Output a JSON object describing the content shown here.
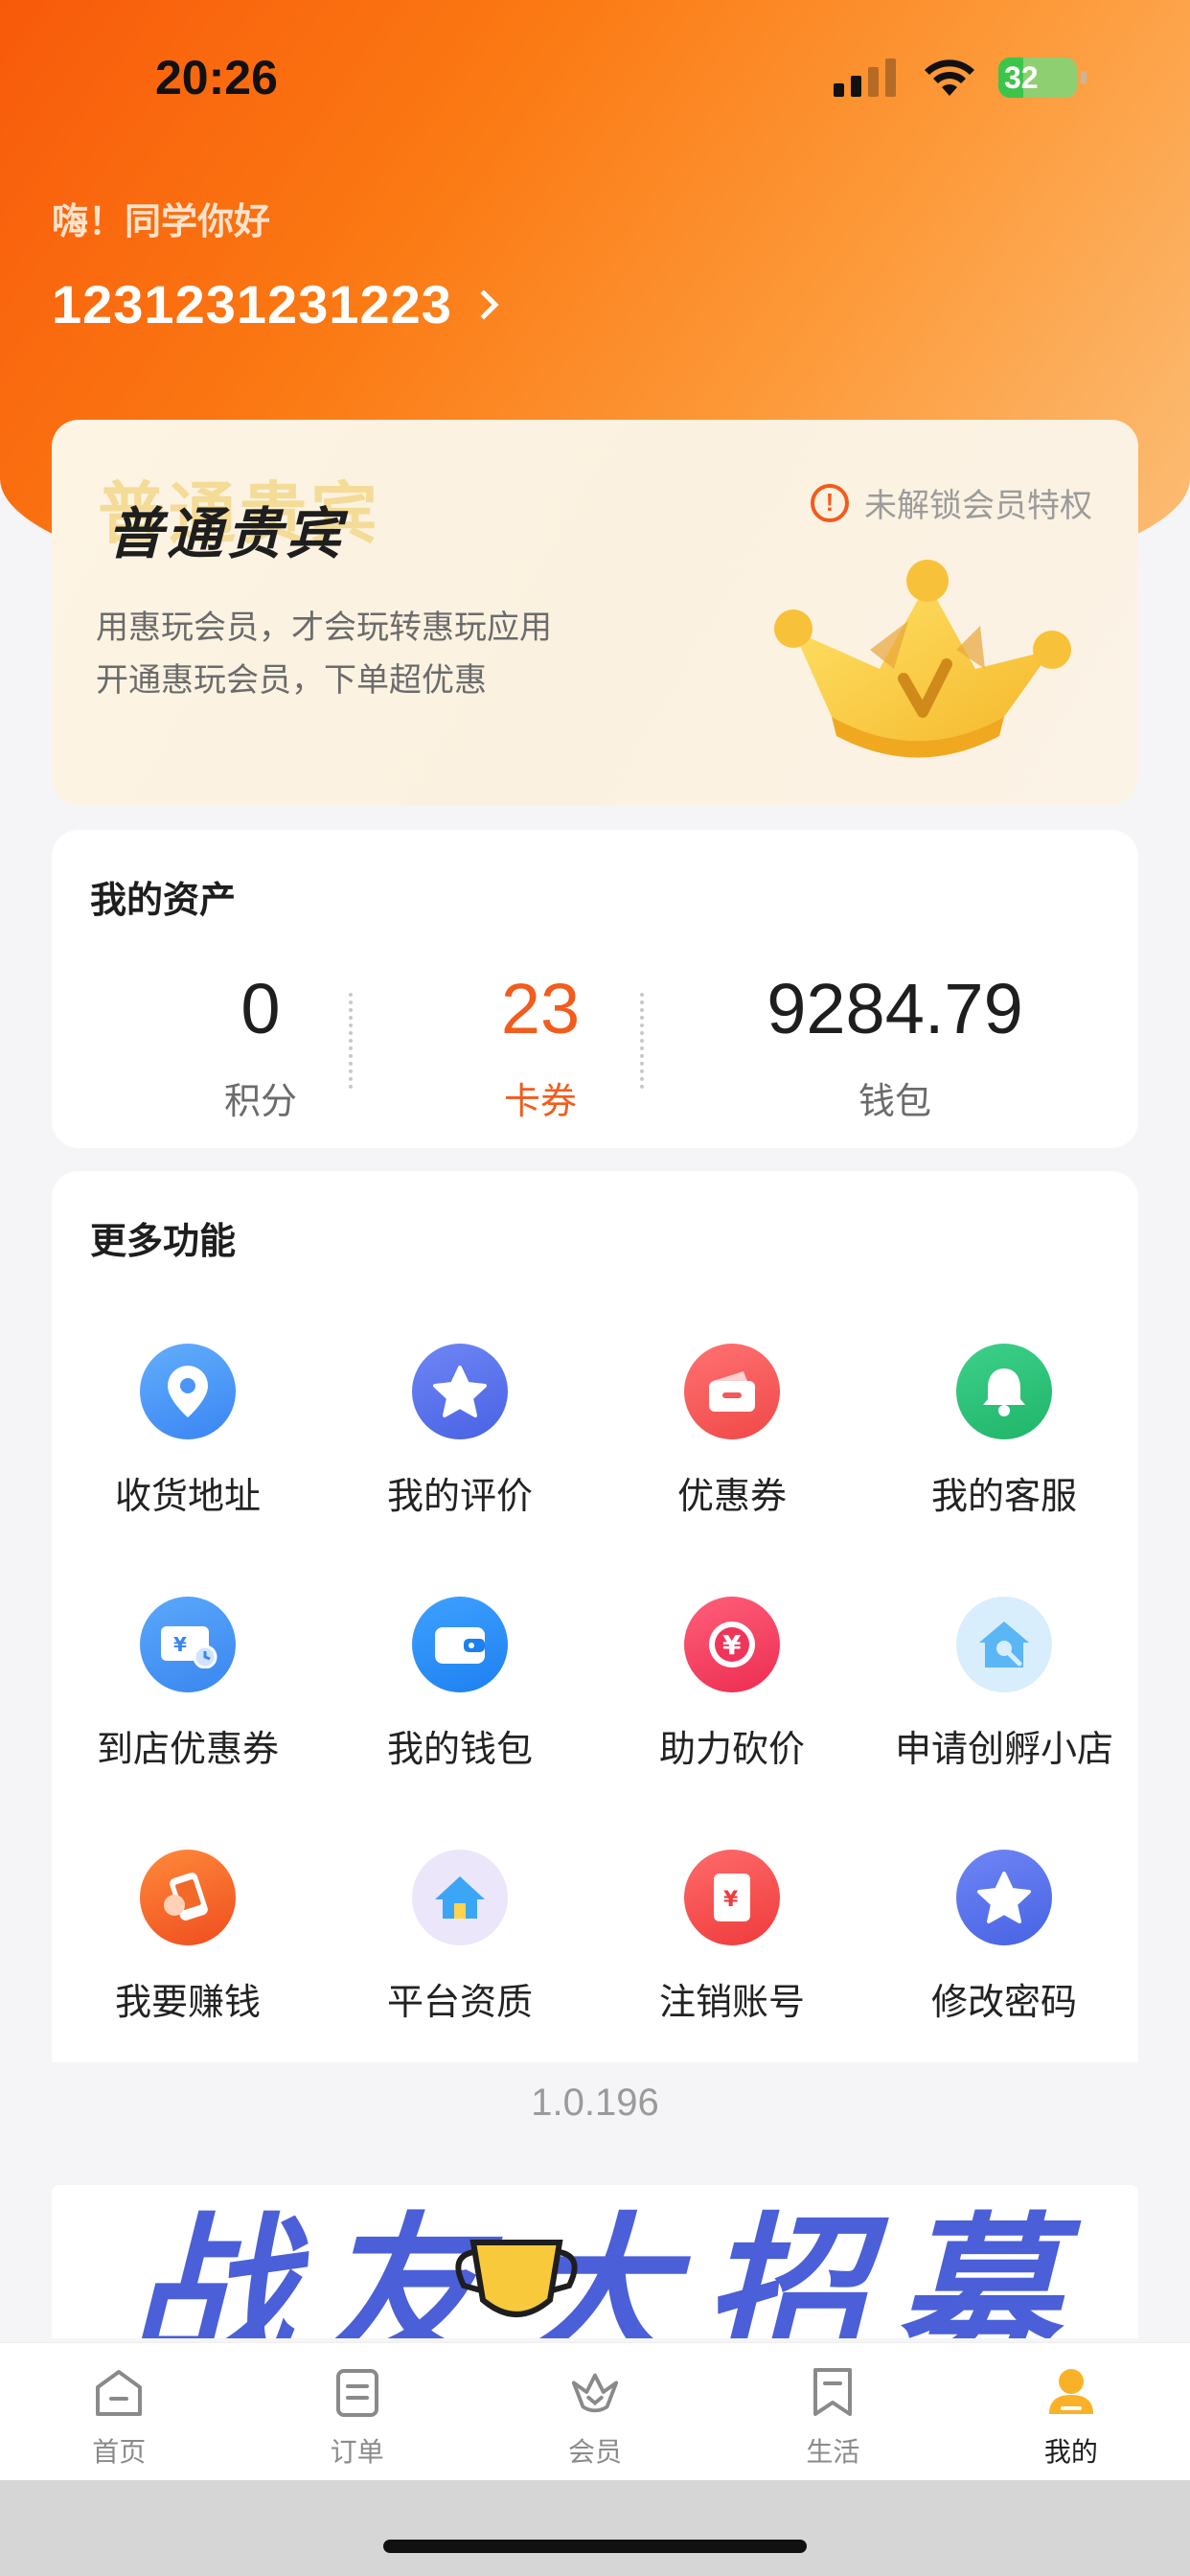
{
  "status_bar": {
    "time": "20:26",
    "battery": "32",
    "battery_level": 0.32
  },
  "header": {
    "greeting": "嗨！同学你好",
    "user_id": "1231231231223"
  },
  "vip_card": {
    "title": "普通贵宾",
    "lock_text": "未解锁会员特权",
    "desc_line1": "用惠玩会员，才会玩转惠玩应用",
    "desc_line2": "开通惠玩会员，下单超优惠"
  },
  "assets": {
    "title": "我的资产",
    "items": [
      {
        "value": "0",
        "label": "积分"
      },
      {
        "value": "23",
        "label": "卡券"
      },
      {
        "value": "9284.79",
        "label": "钱包"
      }
    ]
  },
  "features": {
    "title": "更多功能",
    "items": [
      {
        "label": "收货地址",
        "icon": "location-pin-icon"
      },
      {
        "label": "我的评价",
        "icon": "star-icon"
      },
      {
        "label": "优惠券",
        "icon": "coupon-icon"
      },
      {
        "label": "我的客服",
        "icon": "bell-icon"
      },
      {
        "label": "到店优惠券",
        "icon": "store-coupon-icon"
      },
      {
        "label": "我的钱包",
        "icon": "wallet-icon"
      },
      {
        "label": "助力砍价",
        "icon": "yuan-icon"
      },
      {
        "label": "申请创孵小店",
        "icon": "shop-icon"
      },
      {
        "label": "我要赚钱",
        "icon": "phone-money-icon"
      },
      {
        "label": "平台资质",
        "icon": "home-icon"
      },
      {
        "label": "注销账号",
        "icon": "red-envelope-icon"
      },
      {
        "label": "修改密码",
        "icon": "star-icon"
      }
    ]
  },
  "version": "1.0.196",
  "banner": {
    "text": "战友大招募"
  },
  "tabbar": {
    "items": [
      {
        "label": "首页",
        "icon": "home-tab-icon"
      },
      {
        "label": "订单",
        "icon": "order-tab-icon"
      },
      {
        "label": "会员",
        "icon": "crown-tab-icon"
      },
      {
        "label": "生活",
        "icon": "bookmark-tab-icon"
      },
      {
        "label": "我的",
        "icon": "profile-tab-icon"
      }
    ],
    "active": "我的"
  },
  "colors": {
    "accent": "#f25c1c",
    "header_gradient_start": "#f85a0a",
    "header_gradient_end": "#fcc07a",
    "banner_blue": "#4a5fd8"
  }
}
